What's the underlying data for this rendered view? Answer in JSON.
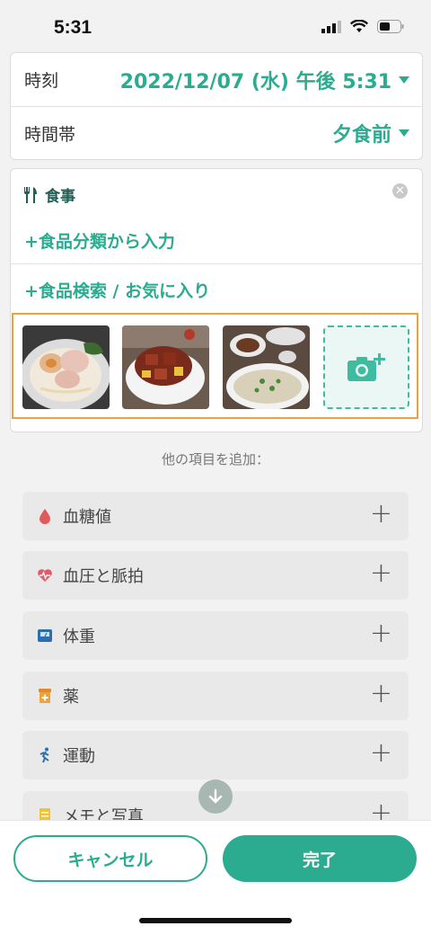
{
  "status_bar": {
    "time": "5:31"
  },
  "datetime_card": {
    "time_label": "時刻",
    "time_value": "2022/12/07 (水) 午後 5:31",
    "period_label": "時間帯",
    "period_value": "夕食前"
  },
  "meal_card": {
    "title": "食事",
    "add_by_category": "+食品分類から入力",
    "add_by_search": "+食品検索 / お気に入り",
    "photos": [
      "ramen-photo",
      "braised-pork-photo",
      "congee-photo"
    ]
  },
  "add_more": {
    "hint": "他の項目を追加：",
    "items": [
      {
        "label": "血糖値",
        "icon": "blood-drop-icon",
        "color": "#e05a5a"
      },
      {
        "label": "血圧と脈拍",
        "icon": "heart-pulse-icon",
        "color": "#e05a6a"
      },
      {
        "label": "体重",
        "icon": "scale-icon",
        "color": "#2c6fb0"
      },
      {
        "label": "薬",
        "icon": "medicine-icon",
        "color": "#f0a23a"
      },
      {
        "label": "運動",
        "icon": "running-icon",
        "color": "#2c6fb0"
      },
      {
        "label": "メモと写真",
        "icon": "note-icon",
        "color": "#f0c23a"
      }
    ]
  },
  "buttons": {
    "cancel": "キャンセル",
    "done": "完了"
  },
  "colors": {
    "accent": "#2bab8f",
    "highlight": "#f0a23a"
  }
}
